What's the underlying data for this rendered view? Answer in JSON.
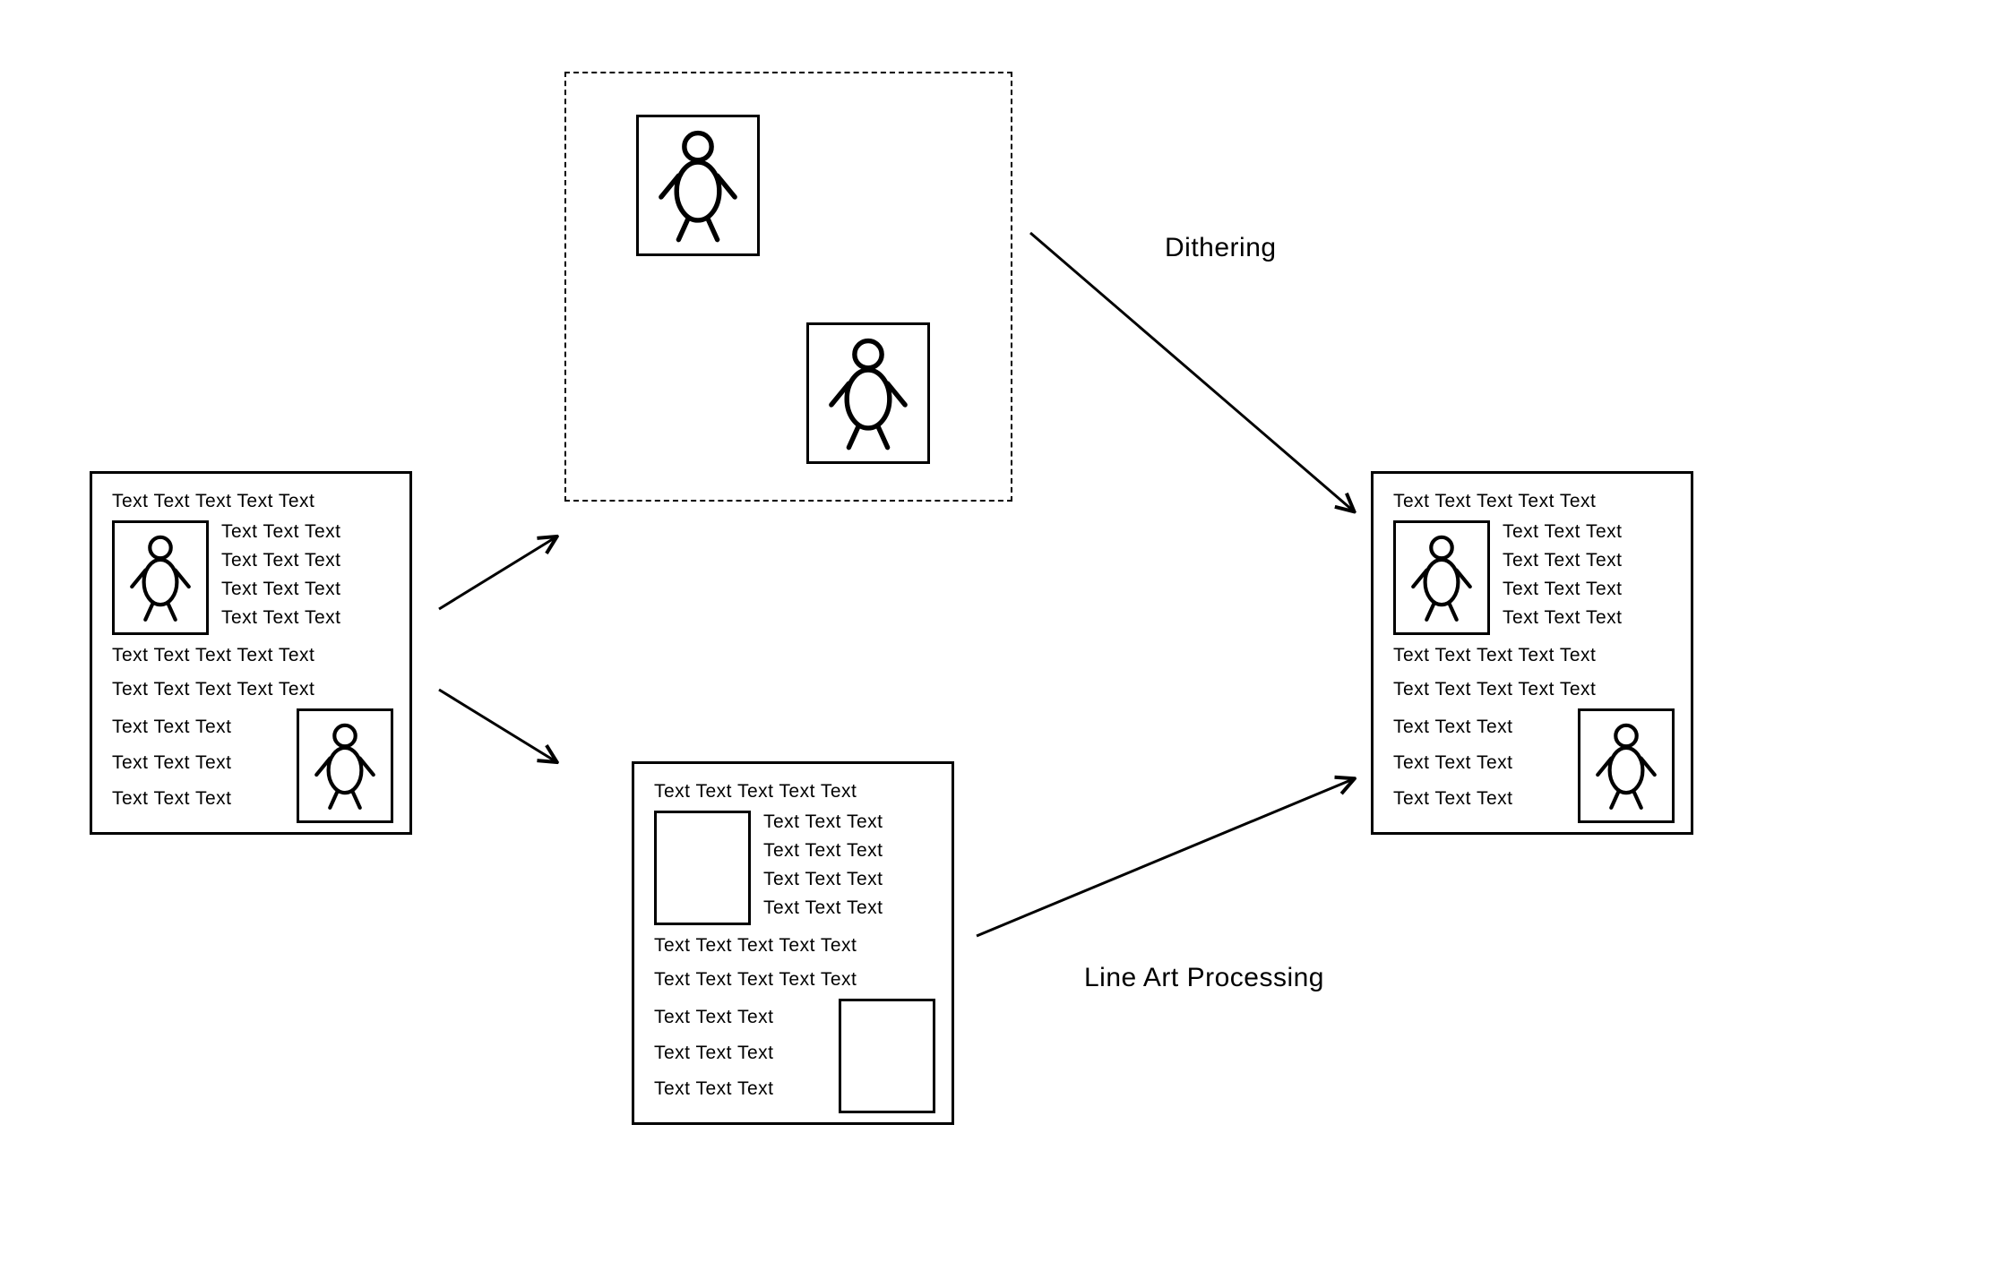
{
  "diagram": {
    "labels": {
      "dithering": "Dithering",
      "line_art": "Line Art Processing"
    },
    "text_words": {
      "five": "Text Text Text Text Text",
      "four": "Text Text Text Text Text",
      "three_right": "Text Text Text",
      "three_left": "Text Text Text"
    },
    "panels": {
      "source": {
        "name": "source-document",
        "lines": [
          "Text Text Text Text Text",
          "Text Text Text",
          "Text Text Text",
          "Text Text Text",
          "Text Text Text",
          "Text Text Text Text Text",
          "Text Text Text Text Text",
          "Text Text Text",
          "Text Text Text",
          "Text Text Text"
        ]
      },
      "images_only": {
        "name": "images-only-region"
      },
      "text_only": {
        "name": "text-only-document",
        "lines": [
          "Text Text Text Text Text",
          "Text Text Text",
          "Text Text Text",
          "Text Text Text",
          "Text Text Text",
          "Text Text Text Text Text",
          "Text Text Text Text Text",
          "Text Text Text",
          "Text Text Text",
          "Text Text Text"
        ]
      },
      "output": {
        "name": "output-document",
        "lines": [
          "Text Text Text Text Text",
          "Text Text Text",
          "Text Text Text",
          "Text Text Text",
          "Text Text Text",
          "Text Text Text Text Text",
          "Text Text Text Text Text",
          "Text Text Text",
          "Text Text Text",
          "Text Text Text"
        ]
      }
    },
    "icons": {
      "stick_figure": "stick-figure-icon"
    }
  }
}
